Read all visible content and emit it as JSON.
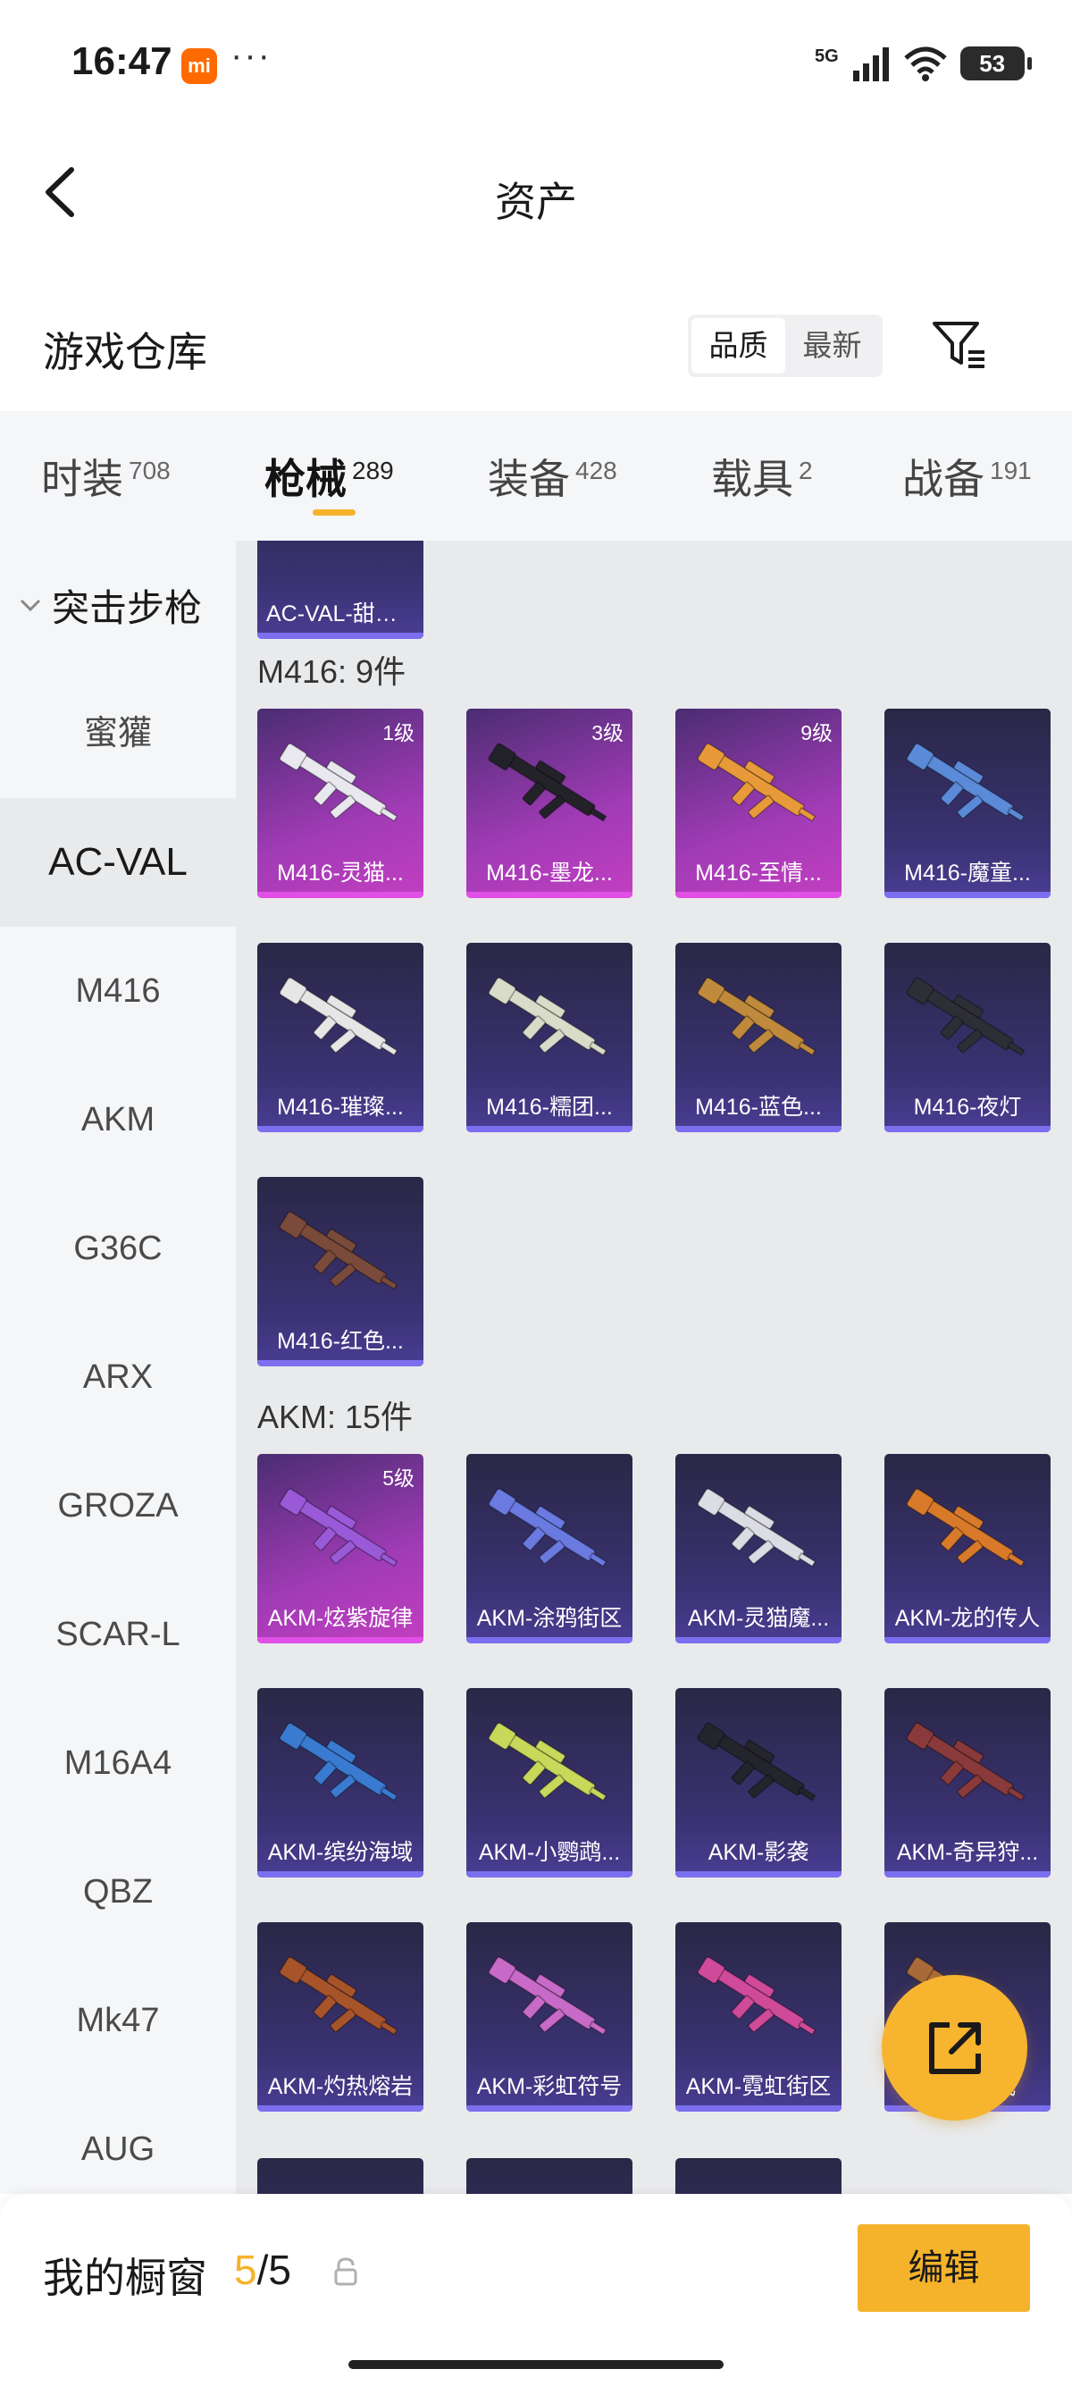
{
  "status_bar": {
    "time": "16:47",
    "mi_badge": "mi",
    "dots": "···",
    "network": "5G",
    "battery": "53"
  },
  "header": {
    "title": "资产"
  },
  "warehouse": {
    "title": "游戏仓库",
    "sort_options": [
      "品质",
      "最新"
    ],
    "active_sort": "品质"
  },
  "tabs": [
    {
      "label": "时装",
      "count": "708"
    },
    {
      "label": "枪械",
      "count": "289"
    },
    {
      "label": "装备",
      "count": "428"
    },
    {
      "label": "载具",
      "count": "2"
    },
    {
      "label": "战备",
      "count": "191"
    }
  ],
  "active_tab": "枪械",
  "left_nav": {
    "group": "突击步枪",
    "items": [
      "蜜獾",
      "AC-VAL",
      "M416",
      "AKM",
      "G36C",
      "ARX",
      "GROZA",
      "SCAR-L",
      "M16A4",
      "QBZ",
      "Mk47",
      "AUG"
    ],
    "active": "AC-VAL"
  },
  "content": {
    "partial_top_card": {
      "name": "AC-VAL-甜猫..."
    },
    "sections": [
      {
        "label": "M416: 9件",
        "items": [
          {
            "name": "M416-灵猫...",
            "level": "1级",
            "rarity": "purple",
            "gun_color": "#e8e8ee"
          },
          {
            "name": "M416-墨龙...",
            "level": "3级",
            "rarity": "purple",
            "gun_color": "#222228"
          },
          {
            "name": "M416-至情...",
            "level": "9级",
            "rarity": "purple",
            "gun_color": "#e89a3a"
          },
          {
            "name": "M416-魔童...",
            "level": "",
            "rarity": "blue",
            "gun_color": "#5a8ad8"
          },
          {
            "name": "M416-璀璨...",
            "level": "",
            "rarity": "blue",
            "gun_color": "#e6e6e6"
          },
          {
            "name": "M416-糯团...",
            "level": "",
            "rarity": "blue",
            "gun_color": "#d8dcc8"
          },
          {
            "name": "M416-蓝色...",
            "level": "",
            "rarity": "blue",
            "gun_color": "#c08a3c"
          },
          {
            "name": "M416-夜灯",
            "level": "",
            "rarity": "blue",
            "gun_color": "#2e2e36"
          },
          {
            "name": "M416-红色...",
            "level": "",
            "rarity": "blue",
            "gun_color": "#7a4a3a"
          }
        ]
      },
      {
        "label": "AKM: 15件",
        "items": [
          {
            "name": "AKM-炫紫旋律",
            "level": "5级",
            "rarity": "purple",
            "gun_color": "#9a5ad8"
          },
          {
            "name": "AKM-涂鸦街区",
            "level": "",
            "rarity": "blue",
            "gun_color": "#6a7ae0"
          },
          {
            "name": "AKM-灵猫魔...",
            "level": "",
            "rarity": "blue",
            "gun_color": "#dcdce4"
          },
          {
            "name": "AKM-龙的传人",
            "level": "",
            "rarity": "blue",
            "gun_color": "#d87a2a"
          },
          {
            "name": "AKM-缤纷海域",
            "level": "",
            "rarity": "blue",
            "gun_color": "#3a7ad0"
          },
          {
            "name": "AKM-小鹦鹉...",
            "level": "",
            "rarity": "blue",
            "gun_color": "#c8d85a"
          },
          {
            "name": "AKM-影袭",
            "level": "",
            "rarity": "blue",
            "gun_color": "#24242c"
          },
          {
            "name": "AKM-奇异狩...",
            "level": "",
            "rarity": "blue",
            "gun_color": "#8a3a3a"
          },
          {
            "name": "AKM-灼热熔岩",
            "level": "",
            "rarity": "blue",
            "gun_color": "#a8542a"
          },
          {
            "name": "AKM-彩虹符号",
            "level": "",
            "rarity": "blue",
            "gun_color": "#c86ac8"
          },
          {
            "name": "AKM-霓虹街区",
            "level": "",
            "rarity": "blue",
            "gun_color": "#d04a9a"
          },
          {
            "name": "AKM-...威",
            "level": "",
            "rarity": "blue",
            "gun_color": "#a86a3a"
          }
        ]
      }
    ]
  },
  "bottom_bar": {
    "label": "我的橱窗",
    "current": "5",
    "total": "/5",
    "edit_label": "编辑"
  },
  "colors": {
    "accent": "#f5b32b",
    "purple_card": "#c23fc0",
    "blue_card": "#3a3272"
  },
  "icons": [
    "back-arrow-icon",
    "filter-icon",
    "chevron-down-icon",
    "lock-icon",
    "share-export-icon"
  ]
}
